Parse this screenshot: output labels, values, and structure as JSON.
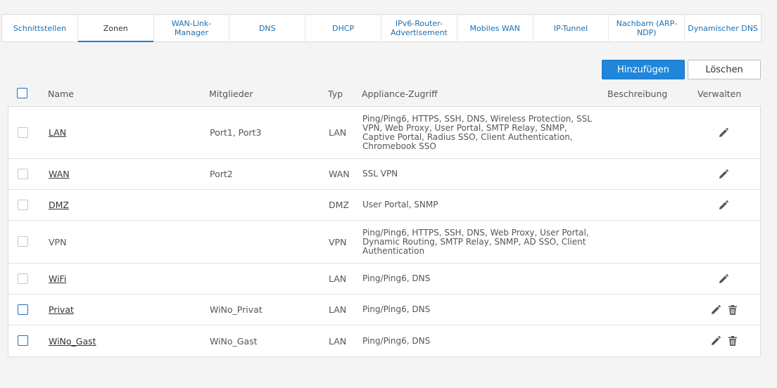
{
  "tabs": [
    {
      "label": "Schnittstellen",
      "active": false
    },
    {
      "label": "Zonen",
      "active": true
    },
    {
      "label": "WAN-Link-Manager",
      "active": false
    },
    {
      "label": "DNS",
      "active": false
    },
    {
      "label": "DHCP",
      "active": false
    },
    {
      "label": "IPv6-Router-Advertisement",
      "active": false
    },
    {
      "label": "Mobiles WAN",
      "active": false
    },
    {
      "label": "IP-Tunnel",
      "active": false
    },
    {
      "label": "Nachbarn (ARP-NDP)",
      "active": false
    },
    {
      "label": "Dynamischer DNS",
      "active": false
    }
  ],
  "toolbar": {
    "add_label": "Hinzufügen",
    "delete_label": "Löschen"
  },
  "columns": {
    "name": "Name",
    "members": "Mitglieder",
    "type": "Typ",
    "access": "Appliance-Zugriff",
    "description": "Beschreibung",
    "manage": "Verwalten"
  },
  "rows": [
    {
      "name": "LAN",
      "members": "Port1, Port3",
      "type": "LAN",
      "access": "Ping/Ping6, HTTPS, SSH, DNS, Wireless Protection, SSL VPN, Web Proxy, User Portal, SMTP Relay, SNMP, Captive Portal, Radius SSO, Client Authentication, Chromebook SSO",
      "editable": true,
      "deletable": false,
      "selectable": false
    },
    {
      "name": "WAN",
      "members": "Port2",
      "type": "WAN",
      "access": "SSL VPN",
      "editable": true,
      "deletable": false,
      "selectable": false
    },
    {
      "name": "DMZ",
      "members": "",
      "type": "DMZ",
      "access": "User Portal, SNMP",
      "editable": true,
      "deletable": false,
      "selectable": false
    },
    {
      "name": "VPN",
      "members": "",
      "type": "VPN",
      "access": "Ping/Ping6, HTTPS, SSH, DNS, Web Proxy, User Portal, Dynamic Routing, SMTP Relay, SNMP, AD SSO, Client Authentication",
      "editable": false,
      "deletable": false,
      "selectable": false
    },
    {
      "name": "WiFi",
      "members": "",
      "type": "LAN",
      "access": "Ping/Ping6, DNS",
      "editable": true,
      "deletable": false,
      "selectable": false
    },
    {
      "name": "Privat",
      "members": "WiNo_Privat",
      "type": "LAN",
      "access": "Ping/Ping6, DNS",
      "editable": true,
      "deletable": true,
      "selectable": true
    },
    {
      "name": "WiNo_Gast",
      "members": "WiNo_Gast",
      "type": "LAN",
      "access": "Ping/Ping6, DNS",
      "editable": true,
      "deletable": true,
      "selectable": true
    }
  ],
  "icons": {
    "edit": "pencil-icon",
    "delete": "trash-icon"
  },
  "colors": {
    "accent": "#1f86d9",
    "link": "#1a6fb3"
  }
}
